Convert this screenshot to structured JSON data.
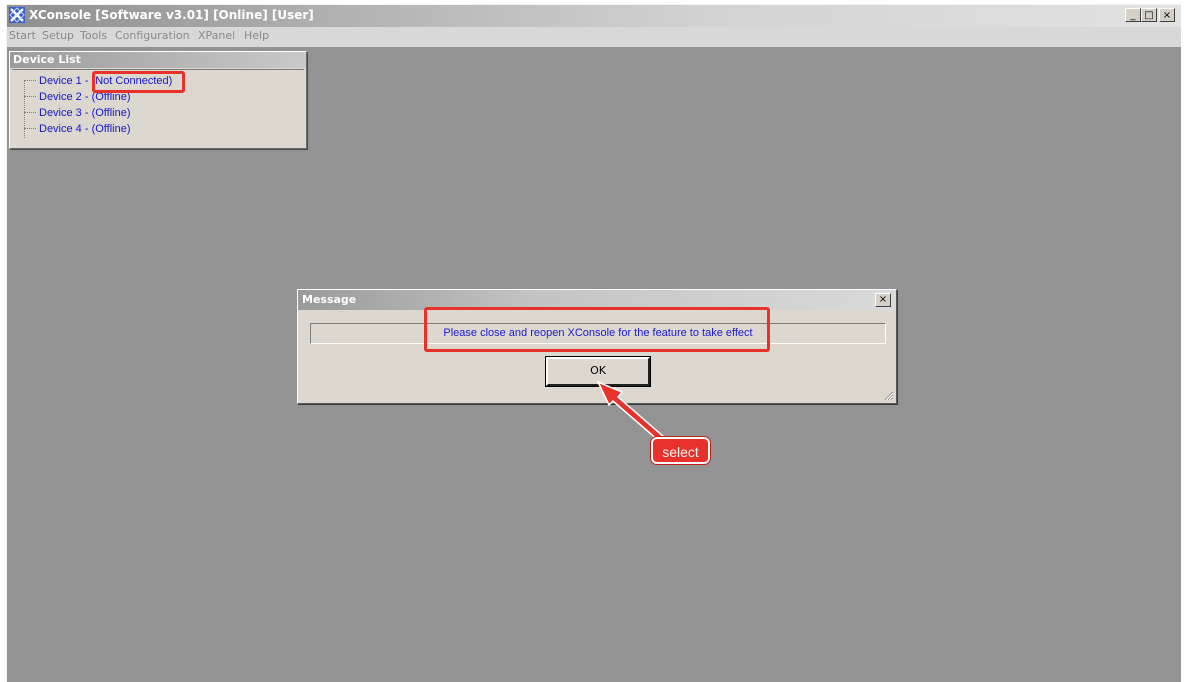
{
  "window": {
    "title": "XConsole [Software v3.01] [Online] [User]",
    "buttons": {
      "minimize": "_",
      "maximize": "□",
      "close": "×"
    }
  },
  "menu": [
    "Start",
    "Setup",
    "Tools",
    "Configuration",
    "XPanel",
    "Help"
  ],
  "device_list": {
    "title": "Device List",
    "items": [
      {
        "name": "Device 1",
        "status": "(Not Connected)"
      },
      {
        "name": "Device 2",
        "status": "(Offline)"
      },
      {
        "name": "Device 3",
        "status": "(Offline)"
      },
      {
        "name": "Device 4",
        "status": "(Offline)"
      }
    ]
  },
  "dialog": {
    "title": "Message",
    "close": "×",
    "message": "Please close and reopen XConsole for the feature to take effect",
    "ok_label": "OK"
  },
  "annotation": {
    "callout_label": "select",
    "highlight_color": "#e8312a"
  },
  "colors": {
    "workspace": "#939393",
    "link_text": "#1616c8"
  }
}
